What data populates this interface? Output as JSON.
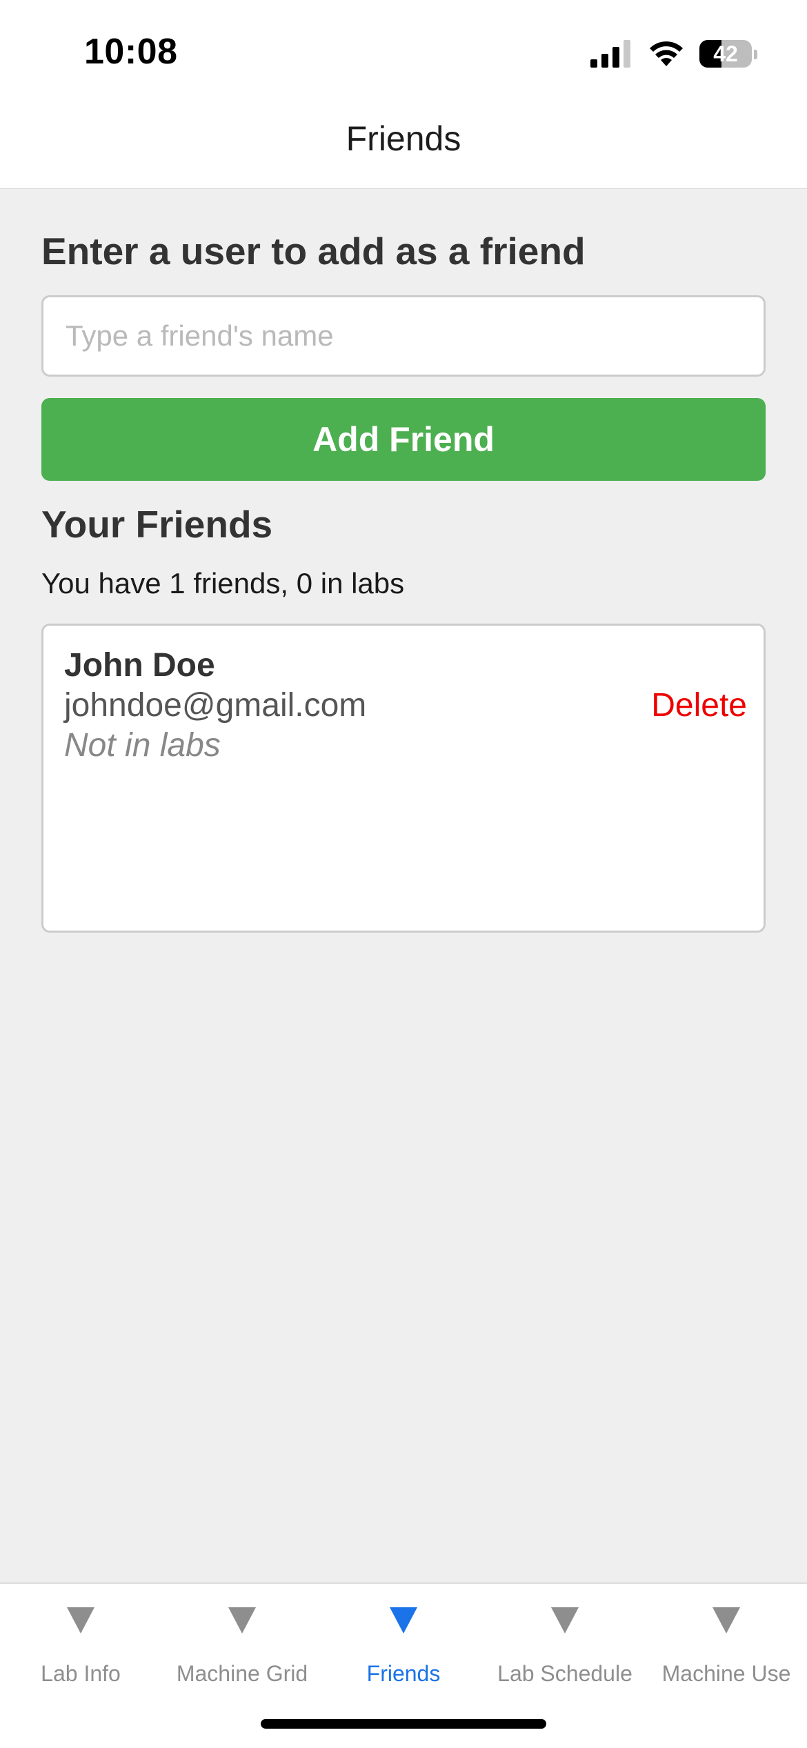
{
  "status_bar": {
    "time": "10:08",
    "battery_level": "42",
    "battery_fraction": 0.42,
    "icons": [
      "signal-icon",
      "wifi-icon",
      "battery-icon"
    ]
  },
  "header": {
    "title": "Friends"
  },
  "add_friend": {
    "heading": "Enter a user to add as a friend",
    "input_placeholder": "Type a friend's name",
    "input_value": "",
    "button_label": "Add Friend"
  },
  "friends": {
    "heading": "Your Friends",
    "summary": "You have 1 friends, 0 in labs",
    "items": [
      {
        "name": "John Doe",
        "email": "johndoe@gmail.com",
        "status": "Not in labs",
        "action_label": "Delete"
      }
    ]
  },
  "tab_bar": {
    "tabs": [
      {
        "label": "Lab Info",
        "icon": "triangle-down-icon"
      },
      {
        "label": "Machine Grid",
        "icon": "triangle-down-icon"
      },
      {
        "label": "Friends",
        "icon": "triangle-down-icon",
        "active": true
      },
      {
        "label": "Lab Schedule",
        "icon": "triangle-down-icon"
      },
      {
        "label": "Machine Use",
        "icon": "triangle-down-icon"
      }
    ]
  },
  "colors": {
    "background": "#efefef",
    "accent_green": "#4caf50",
    "active_tab": "#1a73e8",
    "inactive_tab": "#8e8e8e",
    "delete_red": "#ee0000"
  }
}
